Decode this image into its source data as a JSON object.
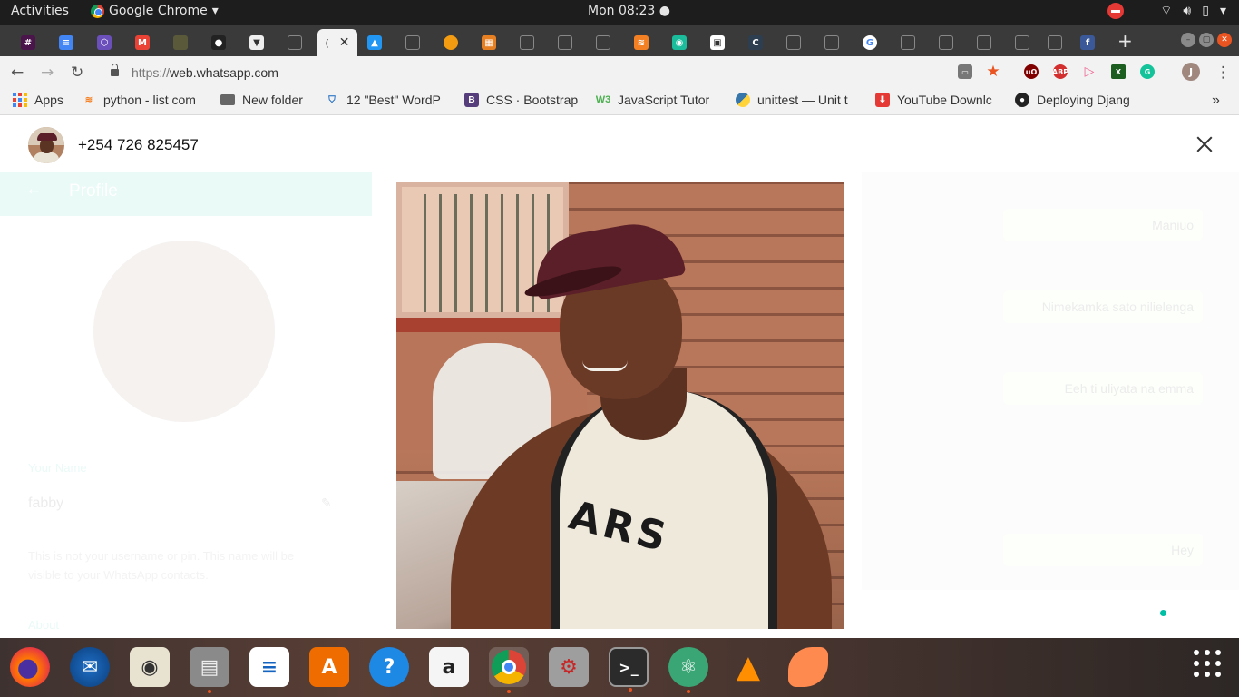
{
  "topbar": {
    "activities": "Activities",
    "app_name": "Google Chrome",
    "clock": "Mon 08:23"
  },
  "browser": {
    "url": "https://web.whatsapp.com",
    "url_scheme": "https://",
    "url_host": "web.whatsapp.com",
    "active_tab_label": "(",
    "profile_initial": "J"
  },
  "bookmarks": [
    {
      "label": "Apps",
      "icon": "apps-grid-icon"
    },
    {
      "label": "python - list com",
      "icon": "stackoverflow-icon"
    },
    {
      "label": "New folder",
      "icon": "folder-icon"
    },
    {
      "label": "12 \"Best\" WordP",
      "icon": "shield-icon"
    },
    {
      "label": "CSS · Bootstrap",
      "icon": "bootstrap-icon"
    },
    {
      "label": "JavaScript Tutor",
      "icon": "w3-icon"
    },
    {
      "label": "unittest — Unit t",
      "icon": "python-icon"
    },
    {
      "label": "YouTube Downlc",
      "icon": "download-icon"
    },
    {
      "label": "Deploying Djang",
      "icon": "github-icon"
    }
  ],
  "extensions": [
    "cast-icon",
    "star-icon",
    "ublock-icon",
    "adblock-icon",
    "extension-icon",
    "excel-icon",
    "grammarly-icon"
  ],
  "viewer": {
    "contact_number": "+254 726 825457"
  },
  "background": {
    "profile_title": "Profile",
    "name_label": "Your Name",
    "name_value": "fabby",
    "name_hint": "This is not your username or pin. This name will be visible to your WhatsApp contacts.",
    "about_label": "About",
    "messages": [
      "Maniuo",
      "Nimekamka sato nilielenga",
      "Eeh ti uliyata na emma",
      "Hey"
    ]
  },
  "photo": {
    "shirt_letters": "ARS"
  },
  "colors": {
    "whatsapp_teal": "#00bfa5",
    "ubuntu_orange": "#e95420"
  },
  "dock": [
    {
      "name": "firefox-icon",
      "running": false
    },
    {
      "name": "thunderbird-icon",
      "running": false
    },
    {
      "name": "rhythmbox-icon",
      "running": false
    },
    {
      "name": "files-icon",
      "running": true
    },
    {
      "name": "writer-icon",
      "running": false
    },
    {
      "name": "software-center-icon",
      "running": false
    },
    {
      "name": "help-icon",
      "running": false
    },
    {
      "name": "amazon-icon",
      "running": false
    },
    {
      "name": "chrome-icon",
      "running": true
    },
    {
      "name": "settings-icon",
      "running": false
    },
    {
      "name": "terminal-icon",
      "running": true
    },
    {
      "name": "atom-icon",
      "running": true
    },
    {
      "name": "vlc-icon",
      "running": false
    },
    {
      "name": "orange-app-icon",
      "running": false
    }
  ]
}
